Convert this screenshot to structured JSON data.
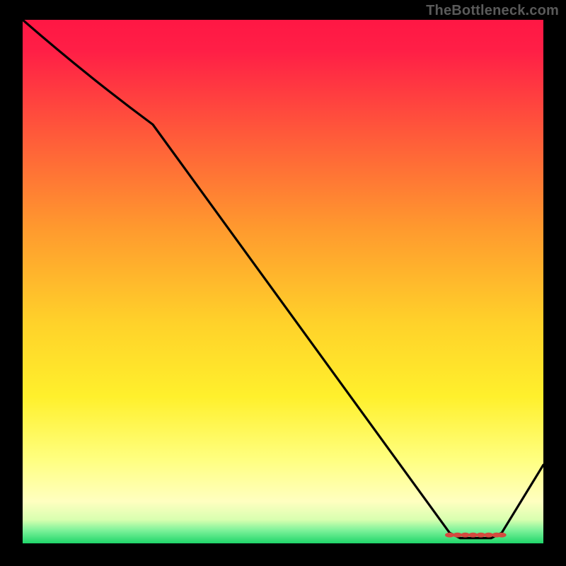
{
  "watermark": "TheBottleneck.com",
  "chart_data": {
    "type": "line",
    "title": "",
    "xlabel": "",
    "ylabel": "",
    "xlim": [
      0,
      100
    ],
    "ylim": [
      0,
      100
    ],
    "x": [
      0,
      25,
      82,
      84,
      86,
      88,
      90,
      92,
      100
    ],
    "values": [
      100,
      80,
      2,
      1,
      1,
      1,
      1,
      2,
      15
    ],
    "curve": {
      "description": "Black curve descending from top-left, roughly linear to ~x=25, then steeper linear descent to a flat minimum near x≈82–92, rising again toward x=100",
      "optimum_band_x": [
        82,
        92
      ]
    },
    "markers": {
      "color": "#d44a3f",
      "near_minimum_x": [
        82,
        83.5,
        85,
        86.5,
        88,
        89.5,
        91,
        92
      ],
      "near_minimum_y": 1.6
    },
    "gradient_stops": [
      {
        "offset": 0.0,
        "color": "#ff1744"
      },
      {
        "offset": 0.06,
        "color": "#ff1f46"
      },
      {
        "offset": 0.22,
        "color": "#ff5a3a"
      },
      {
        "offset": 0.4,
        "color": "#ff9a2e"
      },
      {
        "offset": 0.58,
        "color": "#ffd22a"
      },
      {
        "offset": 0.72,
        "color": "#fff02c"
      },
      {
        "offset": 0.84,
        "color": "#ffff80"
      },
      {
        "offset": 0.92,
        "color": "#ffffc0"
      },
      {
        "offset": 0.955,
        "color": "#d8ffb0"
      },
      {
        "offset": 0.975,
        "color": "#7ef29a"
      },
      {
        "offset": 1.0,
        "color": "#1fd66a"
      }
    ]
  }
}
